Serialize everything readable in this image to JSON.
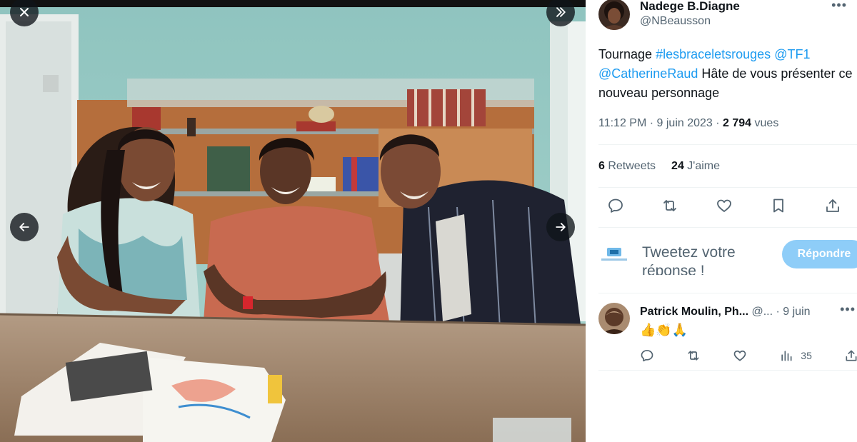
{
  "viewer": {
    "close_icon": "close-icon",
    "expand_icon": "expand-right-icon",
    "prev_icon": "arrow-left-icon",
    "next_icon": "arrow-right-icon"
  },
  "tweet": {
    "author_name": "Nadege B.Diagne",
    "author_handle": "@NBeausson",
    "text": {
      "lead": "Tournage ",
      "hashtag": "#lesbraceletsrouges",
      "mention1": "@TF1",
      "mention2": "@CatherineRaud",
      "rest": " Hâte de vous présenter ce nouveau personnage"
    },
    "time": "11:12 PM · 9 juin 2023 · ",
    "views_count": "2 794",
    "views_label": " vues",
    "retweets_count": "6",
    "retweets_label": " Retweets",
    "likes_count": "24",
    "likes_label": " J'aime"
  },
  "reply_box": {
    "placeholder": "Tweetez votre réponse !",
    "button": "Répondre"
  },
  "reply": {
    "author_name": "Patrick Moulin, Ph...",
    "handle_time": " @... · 9 juin",
    "text": "👍👏🙏",
    "views": "35"
  },
  "colors": {
    "accent": "#1d9bf0",
    "reply_button": "#8ecdf8",
    "secondary_text": "#536471"
  }
}
